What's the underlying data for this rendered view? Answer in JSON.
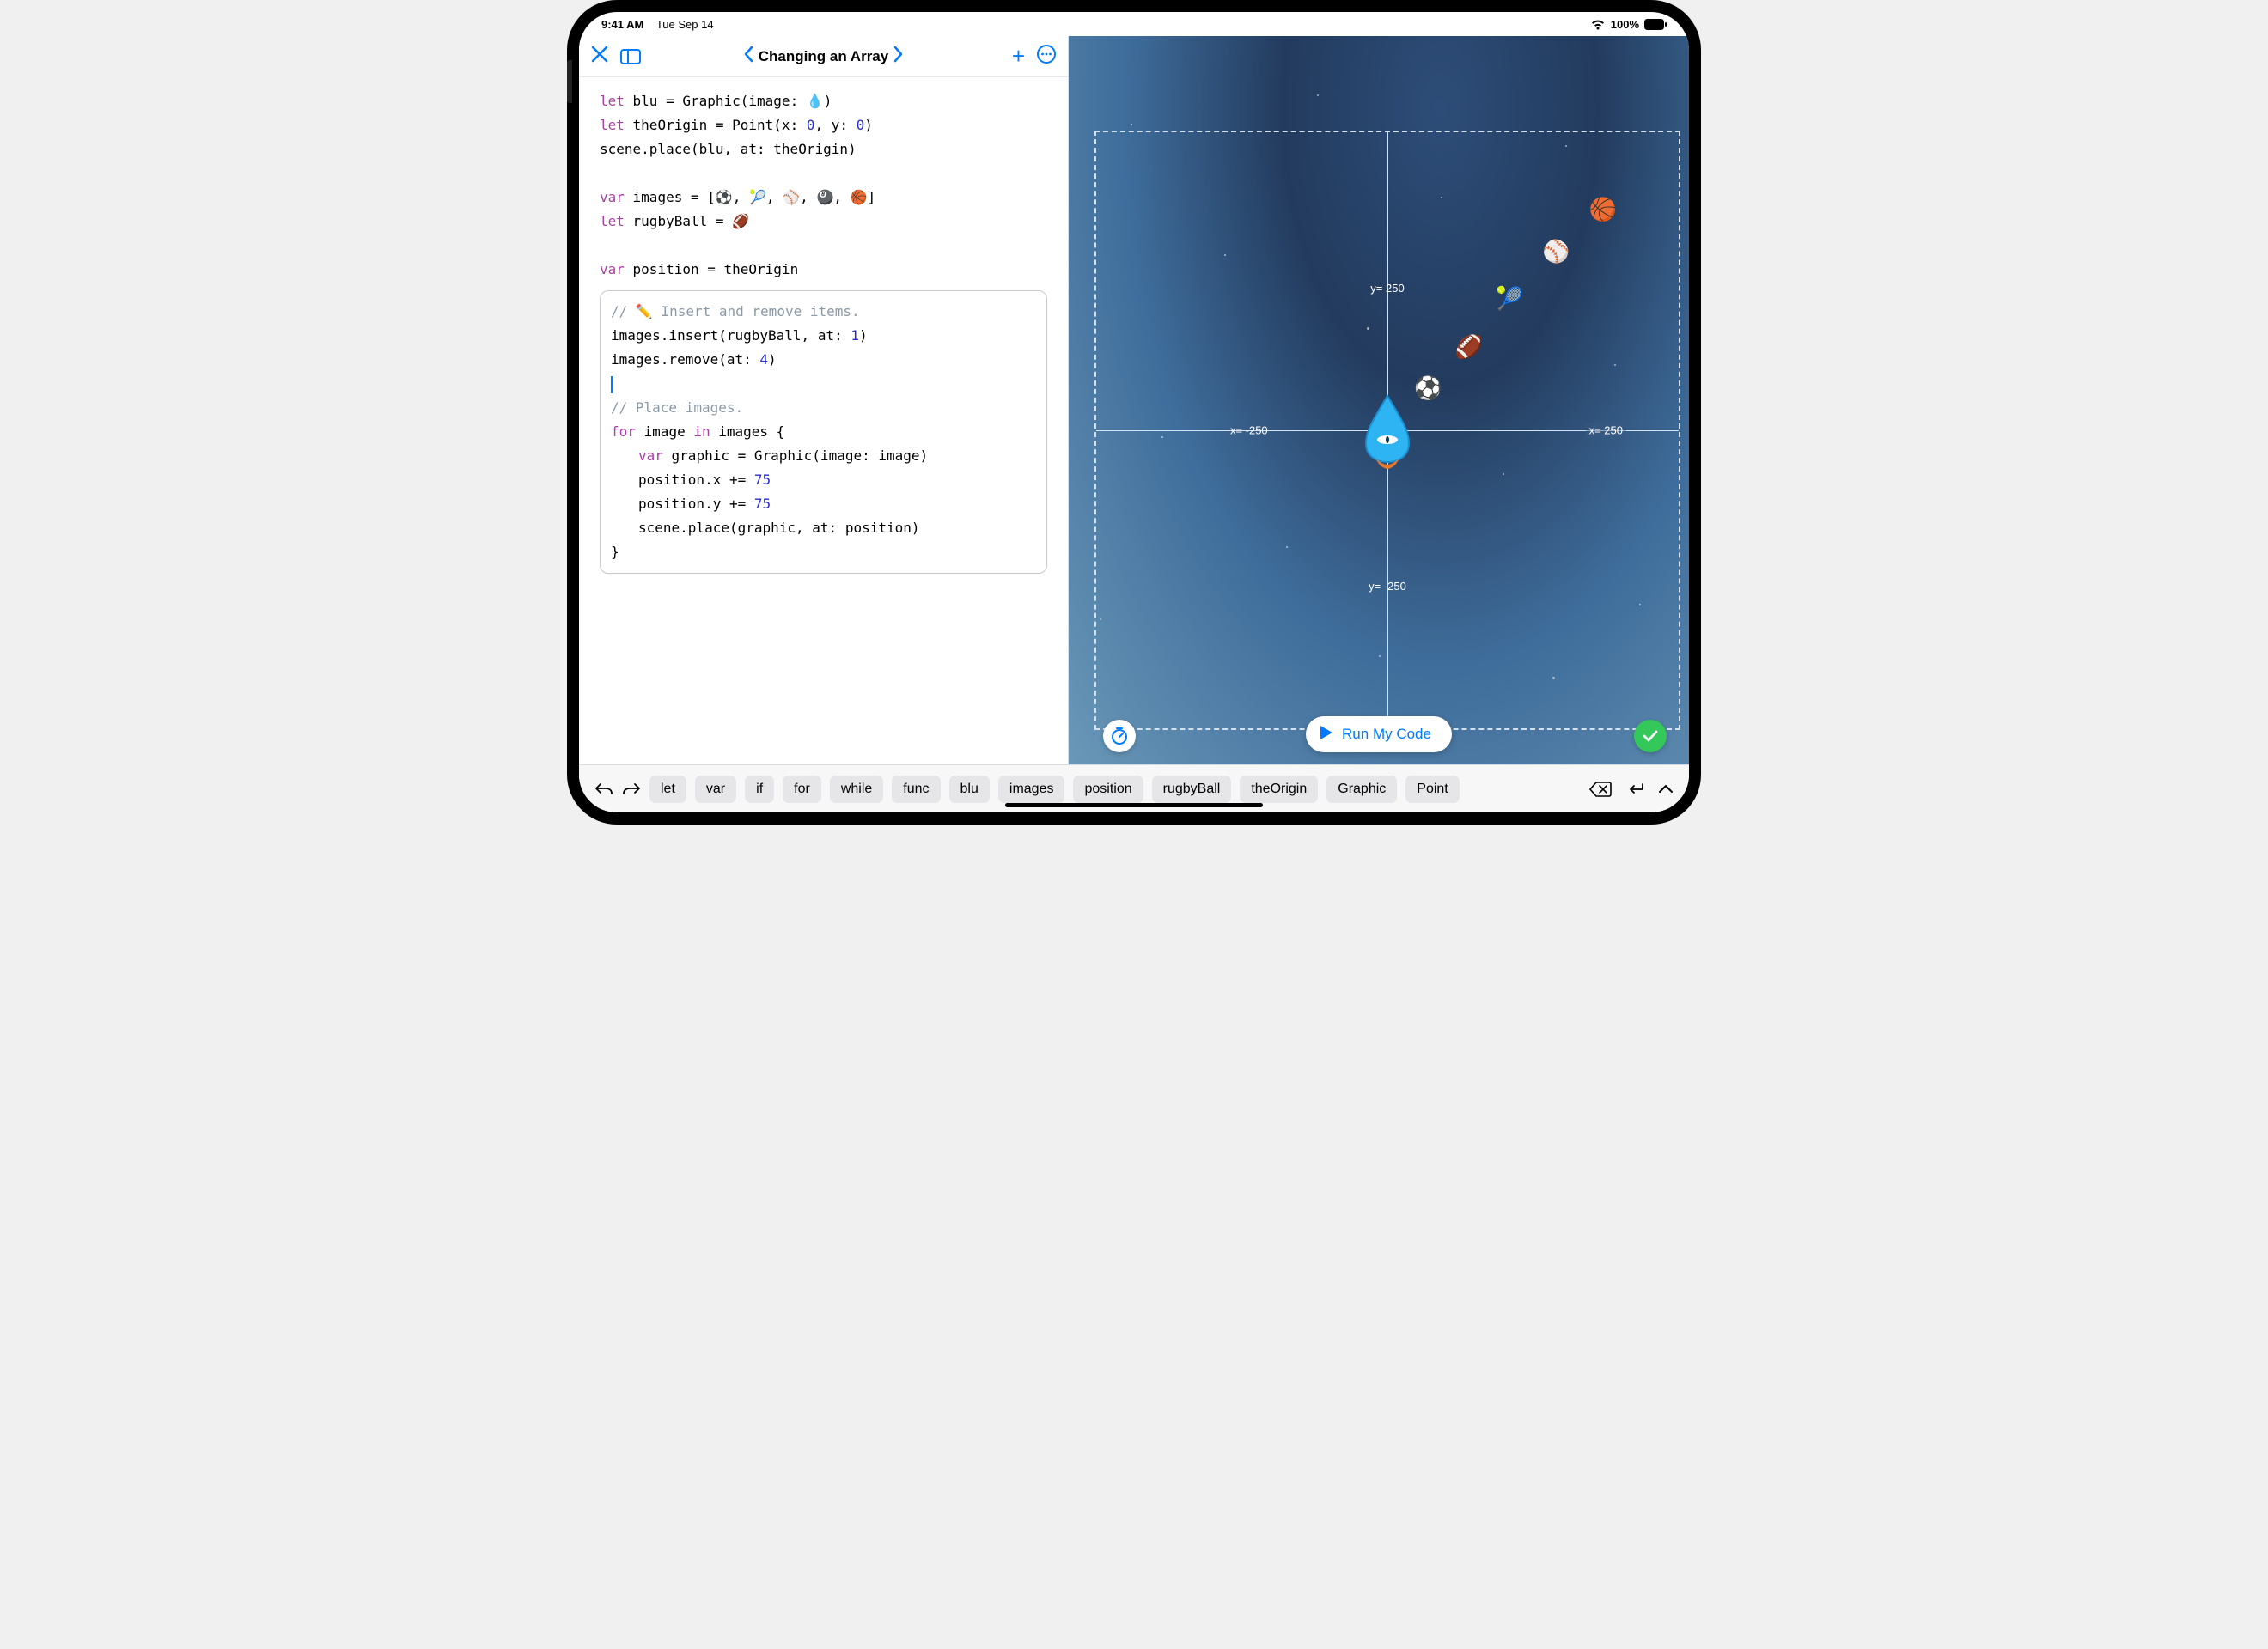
{
  "status_bar": {
    "time": "9:41 AM",
    "date": "Tue Sep 14",
    "battery": "100%"
  },
  "topbar": {
    "title": "Changing an Array"
  },
  "code": {
    "l1_kw": "let",
    "l1_a": " blu = Graphic(image: ",
    "l1_emoji": "💧",
    "l1_b": ")",
    "l2_kw": "let",
    "l2_a": " theOrigin = Point(x: ",
    "l2_n1": "0",
    "l2_b": ", y: ",
    "l2_n2": "0",
    "l2_c": ")",
    "l3": "scene.place(blu, at: theOrigin)",
    "l4_kw": "var",
    "l4_a": " images = [",
    "l4_e1": "⚽️",
    "l4_s": ", ",
    "l4_e2": "🎾",
    "l4_e3": "⚾️",
    "l4_e4": "🎱",
    "l4_e5": "🏀",
    "l4_b": "]",
    "l5_kw": "let",
    "l5_a": " rugbyBall = ",
    "l5_e": "🏈",
    "l6_kw": "var",
    "l6_a": " position = theOrigin",
    "b1_cm": "// ✏️ Insert and remove items.",
    "b2_a": "images.insert(rugbyBall, at: ",
    "b2_n": "1",
    "b2_b": ")",
    "b3_a": "images.remove(at: ",
    "b3_n": "4",
    "b3_b": ")",
    "b4_cm": "// Place images.",
    "b5_kw1": "for",
    "b5_a": " image ",
    "b5_kw2": "in",
    "b5_b": " images {",
    "b6_kw": "var",
    "b6_a": " graphic = Graphic(image: image)",
    "b7_a": "position.x += ",
    "b7_n": "75",
    "b8_a": "position.y += ",
    "b8_n": "75",
    "b9": "scene.place(graphic, at: position)",
    "b10": "}"
  },
  "axes": {
    "xneg": "x= -250",
    "xpos": "x= 250",
    "yneg": "y= -250",
    "ypos": "y= 250"
  },
  "balls": {
    "b1": "⚽️",
    "b2": "🏈",
    "b3": "🎾",
    "b4": "⚾️",
    "b5": "🏀"
  },
  "run": {
    "label": "Run My Code"
  },
  "suggestions": {
    "chips": [
      "let",
      "var",
      "if",
      "for",
      "while",
      "func",
      "blu",
      "images",
      "position",
      "rugbyBall",
      "theOrigin",
      "Graphic",
      "Point"
    ]
  }
}
